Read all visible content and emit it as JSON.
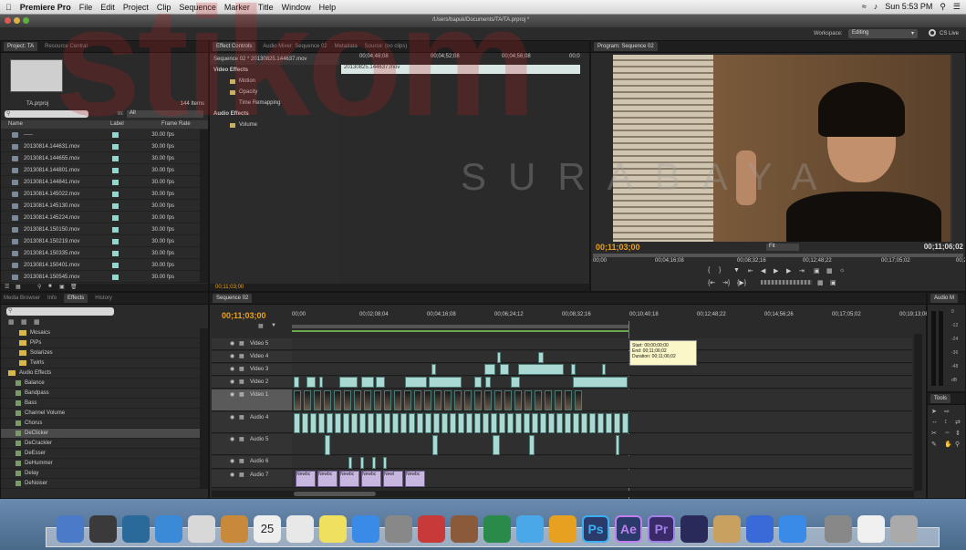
{
  "menubar": {
    "apple": "",
    "app": "Premiere Pro",
    "items": [
      "File",
      "Edit",
      "Project",
      "Clip",
      "Sequence",
      "Marker",
      "Title",
      "Window",
      "Help"
    ],
    "clock": "Sun 5:53 PM"
  },
  "window": {
    "path": "/Users/bapuk/Documents/TA/TA.prproj *",
    "workspace_label": "Workspace:",
    "workspace_value": "Editing",
    "cs_live": "CS Live"
  },
  "project": {
    "tabs": [
      "Project: TA",
      "Resource Central"
    ],
    "filename": "TA.prproj",
    "count": "144 Items",
    "in_label": "In:",
    "in_value": "All",
    "columns": [
      "Name",
      "Label",
      "Frame Rate"
    ],
    "rows": [
      {
        "name": "-----",
        "fps": "30.00 fps"
      },
      {
        "name": "20130814.144631.mov",
        "fps": "30.00 fps"
      },
      {
        "name": "20130814.144655.mov",
        "fps": "30.00 fps"
      },
      {
        "name": "20130814.144801.mov",
        "fps": "30.00 fps"
      },
      {
        "name": "20130814.144841.mov",
        "fps": "30.00 fps"
      },
      {
        "name": "20130814.145022.mov",
        "fps": "30.00 fps"
      },
      {
        "name": "20130814.145130.mov",
        "fps": "30.00 fps"
      },
      {
        "name": "20130814.145224.mov",
        "fps": "30.00 fps"
      },
      {
        "name": "20130814.150150.mov",
        "fps": "30.00 fps"
      },
      {
        "name": "20130814.150219.mov",
        "fps": "30.00 fps"
      },
      {
        "name": "20130814.150335.mov",
        "fps": "30.00 fps"
      },
      {
        "name": "20130814.150401.mov",
        "fps": "30.00 fps"
      },
      {
        "name": "20130814.150545.mov",
        "fps": "30.00 fps"
      }
    ]
  },
  "effect_controls": {
    "tabs": [
      "Effect Controls",
      "Audio Mixer: Sequence 02",
      "Metadata",
      "Source: (no clips)"
    ],
    "seq": "Sequence 02 * 20130825.144637.mov",
    "times": [
      "00;04;48;08",
      "00;04;52;08",
      "00;04;56;08",
      "00;0"
    ],
    "clip": "20130825.144637.mov",
    "items": [
      "Video Effects",
      "Motion",
      "Opacity",
      "Time Remapping",
      "Audio Effects",
      "Volume"
    ],
    "timecode": "00;11;03;00"
  },
  "program": {
    "tab": "Program: Sequence 02",
    "timecode": "00;11;03;00",
    "fit": "Fit",
    "duration": "00;11;06;02",
    "ticks": [
      "00;00",
      "00;04;16;08",
      "00;08;32;16",
      "00;12;48;22",
      "00;17;05;02",
      "00;2"
    ]
  },
  "effects": {
    "tabs": [
      "Media Browser",
      "Info",
      "Effects",
      "History"
    ],
    "items": [
      {
        "t": "Mosaics",
        "folder": true
      },
      {
        "t": "PiPs",
        "folder": true
      },
      {
        "t": "Solarizes",
        "folder": true
      },
      {
        "t": "Twirls",
        "folder": true
      },
      {
        "t": "Audio Effects",
        "folder": true,
        "open": true
      },
      {
        "t": "Balance"
      },
      {
        "t": "Bandpass"
      },
      {
        "t": "Bass"
      },
      {
        "t": "Channel Volume"
      },
      {
        "t": "Chorus"
      },
      {
        "t": "DeClicker",
        "sel": true
      },
      {
        "t": "DeCrackler"
      },
      {
        "t": "DeEsser"
      },
      {
        "t": "DeHummer"
      },
      {
        "t": "Delay"
      },
      {
        "t": "DeNoiser"
      }
    ]
  },
  "timeline": {
    "tab": "Sequence 02",
    "timecode": "00;11;03;00",
    "ruler": [
      "00;00",
      "00;02;08;04",
      "00;04;16;08",
      "00;06;24;12",
      "00;08;32;16",
      "00;10;40;18",
      "00;12;48;22",
      "00;14;56;26",
      "00;17;05;02",
      "00;19;13;06"
    ],
    "tracks": [
      "Video 5",
      "Video 4",
      "Video 3",
      "Video 2",
      "Video 1",
      "Audio 4",
      "Audio 5",
      "Audio 6",
      "Audio 7"
    ],
    "tooltip": [
      "Start: 00;00;00;00",
      "End: 00;11;06;02",
      "Duration: 00;11;06;02"
    ],
    "title_clips": [
      "Newbc",
      "Newbc",
      "Newbc",
      "Newbc",
      "Newl",
      "Newbc"
    ]
  },
  "audio_meter": {
    "tab": "Audio M",
    "labels": [
      "0",
      "-12",
      "-24",
      "-36",
      "-48",
      "dB"
    ]
  },
  "tools": {
    "tab": "Tools"
  },
  "watermark": {
    "main": "stikom",
    "sub": "SURABAYA"
  },
  "dock": {
    "apps": [
      "Ai",
      "Ps",
      "Ae",
      "Pr"
    ],
    "calendar": "25"
  }
}
